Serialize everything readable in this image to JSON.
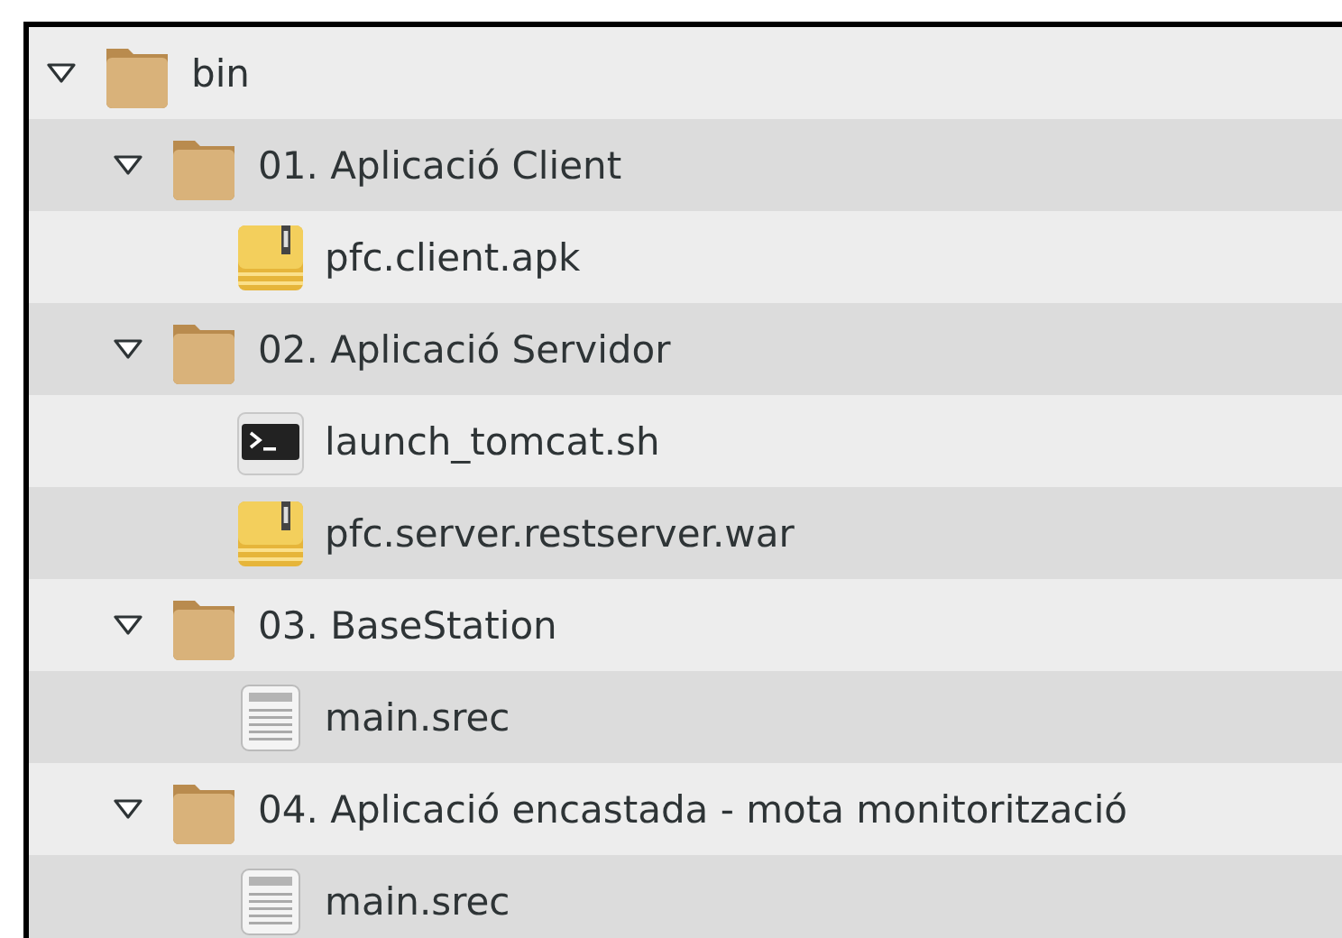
{
  "tree": [
    {
      "name": "bin",
      "kind": "folder",
      "expanded": true,
      "children": [
        {
          "name": "01. Aplicació Client",
          "kind": "folder",
          "expanded": true,
          "children": [
            {
              "name": "pfc.client.apk",
              "kind": "archive"
            }
          ]
        },
        {
          "name": "02. Aplicació Servidor",
          "kind": "folder",
          "expanded": true,
          "children": [
            {
              "name": "launch_tomcat.sh",
              "kind": "script"
            },
            {
              "name": "pfc.server.restserver.war",
              "kind": "archive"
            }
          ]
        },
        {
          "name": "03. BaseStation",
          "kind": "folder",
          "expanded": true,
          "children": [
            {
              "name": "main.srec",
              "kind": "text"
            }
          ]
        },
        {
          "name": "04. Aplicació encastada - mota monitorització",
          "kind": "folder",
          "expanded": true,
          "children": [
            {
              "name": "main.srec",
              "kind": "text"
            }
          ]
        }
      ]
    }
  ]
}
